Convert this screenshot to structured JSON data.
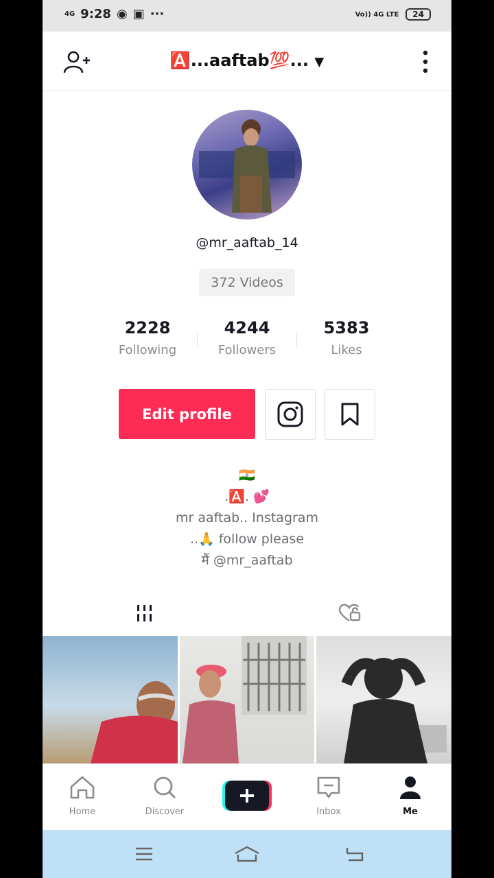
{
  "status_bar": {
    "signal": "4G",
    "time": "9:28",
    "network": "Vo)) 4G LTE",
    "battery": "24"
  },
  "header": {
    "title": "🅰️...aaftab💯...",
    "dropdown_icon": "caret-down-icon"
  },
  "profile": {
    "username": "@mr_aaftab_14",
    "videos_label": "372 Videos",
    "stats": [
      {
        "value": "2228",
        "label": "Following"
      },
      {
        "value": "4244",
        "label": "Followers"
      },
      {
        "value": "5383",
        "label": "Likes"
      }
    ],
    "edit_label": "Edit profile",
    "bio": [
      "🇮🇳",
      ".🅰️.  💕",
      "mr aaftab.. Instagram",
      "..🙏 follow please",
      "मैं @mr_aaftab"
    ]
  },
  "tabs": {
    "videos_icon": "grid-icon",
    "liked_icon": "private-liked-icon"
  },
  "nav": {
    "home": "Home",
    "discover": "Discover",
    "inbox": "Inbox",
    "me": "Me"
  },
  "colors": {
    "accent": "#fe2c55",
    "sysnav": "#bfe0f6"
  }
}
